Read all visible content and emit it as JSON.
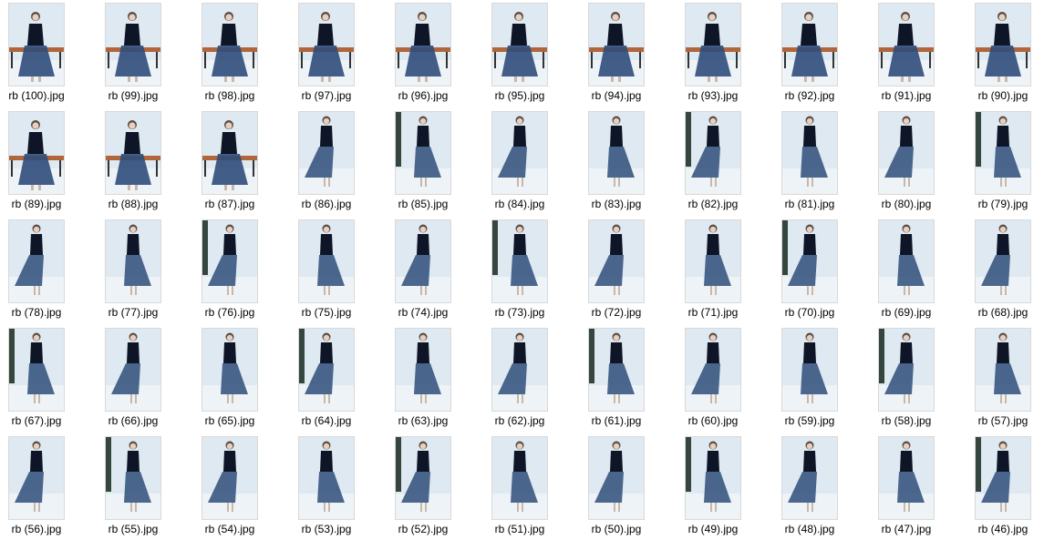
{
  "files": [
    {
      "name": "rb (100).jpg",
      "scene": "bench"
    },
    {
      "name": "rb (99).jpg",
      "scene": "bench"
    },
    {
      "name": "rb (98).jpg",
      "scene": "bench"
    },
    {
      "name": "rb (97).jpg",
      "scene": "bench"
    },
    {
      "name": "rb (96).jpg",
      "scene": "bench"
    },
    {
      "name": "rb (95).jpg",
      "scene": "bench"
    },
    {
      "name": "rb (94).jpg",
      "scene": "bench"
    },
    {
      "name": "rb (93).jpg",
      "scene": "bench"
    },
    {
      "name": "rb (92).jpg",
      "scene": "bench"
    },
    {
      "name": "rb (91).jpg",
      "scene": "bench"
    },
    {
      "name": "rb (90).jpg",
      "scene": "bench"
    },
    {
      "name": "rb (89).jpg",
      "scene": "bench"
    },
    {
      "name": "rb (88).jpg",
      "scene": "bench"
    },
    {
      "name": "rb (87).jpg",
      "scene": "bench"
    },
    {
      "name": "rb (86).jpg",
      "scene": "standing"
    },
    {
      "name": "rb (85).jpg",
      "scene": "standing"
    },
    {
      "name": "rb (84).jpg",
      "scene": "standing"
    },
    {
      "name": "rb (83).jpg",
      "scene": "standing"
    },
    {
      "name": "rb (82).jpg",
      "scene": "standing"
    },
    {
      "name": "rb (81).jpg",
      "scene": "standing"
    },
    {
      "name": "rb (80).jpg",
      "scene": "standing"
    },
    {
      "name": "rb (79).jpg",
      "scene": "standing"
    },
    {
      "name": "rb (78).jpg",
      "scene": "standing"
    },
    {
      "name": "rb (77).jpg",
      "scene": "standing"
    },
    {
      "name": "rb (76).jpg",
      "scene": "standing"
    },
    {
      "name": "rb (75).jpg",
      "scene": "standing"
    },
    {
      "name": "rb (74).jpg",
      "scene": "standing"
    },
    {
      "name": "rb (73).jpg",
      "scene": "standing"
    },
    {
      "name": "rb (72).jpg",
      "scene": "standing"
    },
    {
      "name": "rb (71).jpg",
      "scene": "standing"
    },
    {
      "name": "rb (70).jpg",
      "scene": "standing"
    },
    {
      "name": "rb (69).jpg",
      "scene": "standing"
    },
    {
      "name": "rb (68).jpg",
      "scene": "standing"
    },
    {
      "name": "rb (67).jpg",
      "scene": "standing"
    },
    {
      "name": "rb (66).jpg",
      "scene": "standing"
    },
    {
      "name": "rb (65).jpg",
      "scene": "standing"
    },
    {
      "name": "rb (64).jpg",
      "scene": "standing"
    },
    {
      "name": "rb (63).jpg",
      "scene": "standing"
    },
    {
      "name": "rb (62).jpg",
      "scene": "standing"
    },
    {
      "name": "rb (61).jpg",
      "scene": "standing"
    },
    {
      "name": "rb (60).jpg",
      "scene": "standing"
    },
    {
      "name": "rb (59).jpg",
      "scene": "standing"
    },
    {
      "name": "rb (58).jpg",
      "scene": "standing"
    },
    {
      "name": "rb (57).jpg",
      "scene": "standing"
    },
    {
      "name": "rb (56).jpg",
      "scene": "standing"
    },
    {
      "name": "rb (55).jpg",
      "scene": "standing"
    },
    {
      "name": "rb (54).jpg",
      "scene": "standing"
    },
    {
      "name": "rb (53).jpg",
      "scene": "standing"
    },
    {
      "name": "rb (52).jpg",
      "scene": "standing"
    },
    {
      "name": "rb (51).jpg",
      "scene": "standing"
    },
    {
      "name": "rb (50).jpg",
      "scene": "standing"
    },
    {
      "name": "rb (49).jpg",
      "scene": "standing"
    },
    {
      "name": "rb (48).jpg",
      "scene": "standing"
    },
    {
      "name": "rb (47).jpg",
      "scene": "standing"
    },
    {
      "name": "rb (46).jpg",
      "scene": "standing"
    }
  ]
}
